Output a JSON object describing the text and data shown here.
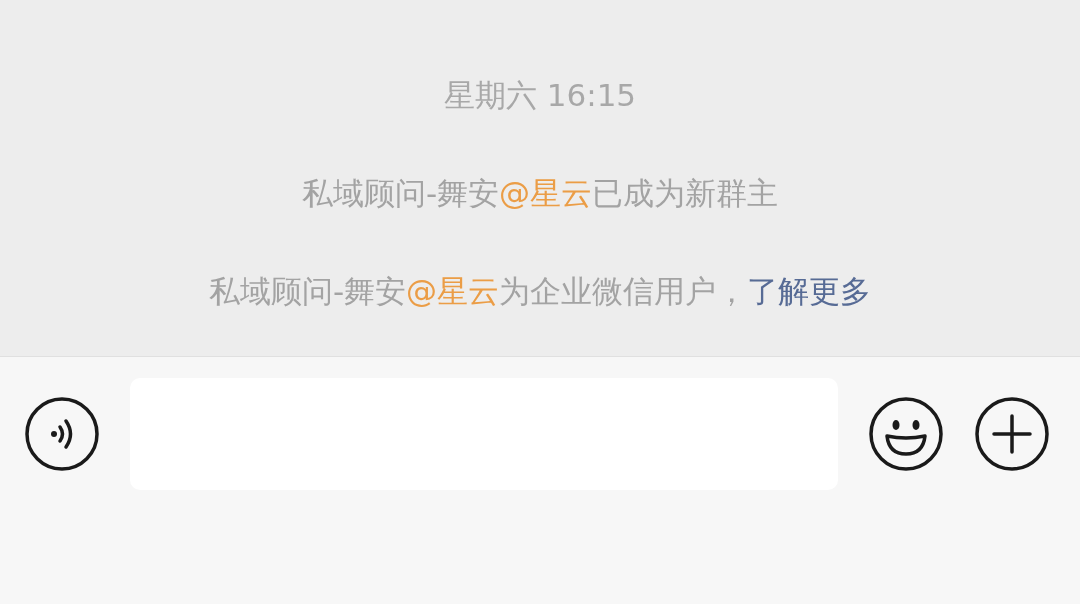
{
  "chat": {
    "timestamp": "星期六 16:15",
    "system_messages": [
      {
        "parts": [
          {
            "kind": "text",
            "text": "私域顾问-舞安"
          },
          {
            "kind": "mention",
            "text": "@星云"
          },
          {
            "kind": "text",
            "text": "已成为新群主"
          }
        ]
      },
      {
        "parts": [
          {
            "kind": "text",
            "text": "私域顾问-舞安"
          },
          {
            "kind": "mention",
            "text": "@星云"
          },
          {
            "kind": "text",
            "text": "为企业微信用户，"
          },
          {
            "kind": "link",
            "text": "了解更多"
          }
        ]
      }
    ]
  },
  "input_bar": {
    "buttons": [
      {
        "kind": "voice"
      },
      {
        "kind": "field"
      },
      {
        "kind": "emoji"
      },
      {
        "kind": "plus"
      }
    ]
  }
}
